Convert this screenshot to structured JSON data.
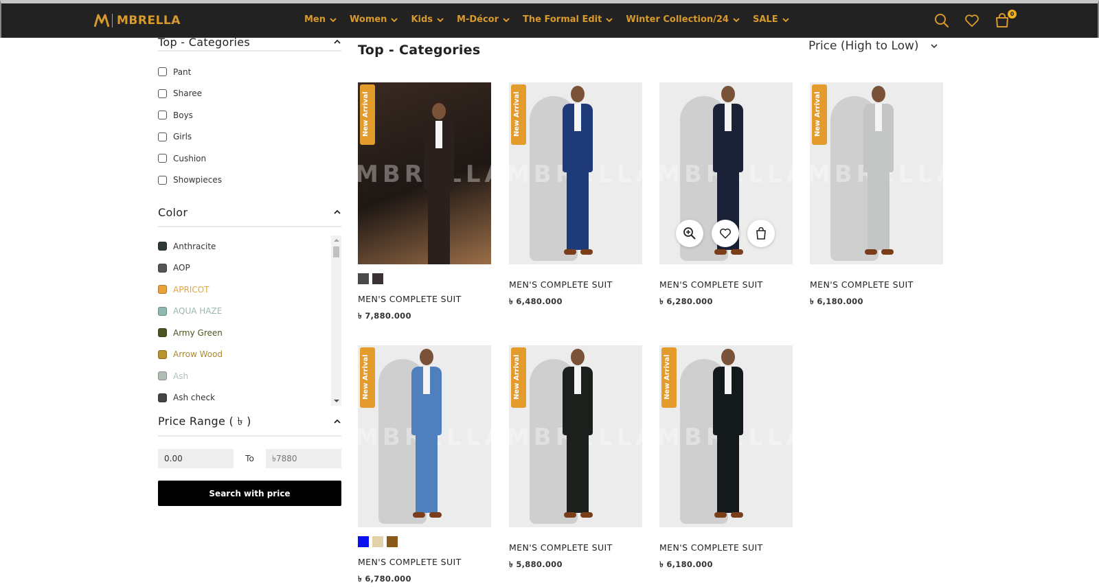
{
  "brand": {
    "name": "MBRELLA",
    "accent": "#d89a2b"
  },
  "nav": {
    "items": [
      {
        "label": "Men",
        "icon": "chevron-down-icon"
      },
      {
        "label": "Women",
        "icon": "chevron-down-icon"
      },
      {
        "label": "Kids",
        "icon": "chevron-down-icon"
      },
      {
        "label": "M-Décor",
        "icon": "chevron-down-icon"
      },
      {
        "label": "The Formal Edit",
        "icon": "chevron-down-icon"
      },
      {
        "label": "Winter Collection/24",
        "icon": "chevron-down-icon"
      },
      {
        "label": "SALE",
        "icon": "chevron-down-icon"
      }
    ],
    "icons": [
      "search-icon",
      "heart-icon",
      "cart-icon"
    ],
    "cart_count": "0"
  },
  "sidebar": {
    "categories": {
      "title": "Top - Categories",
      "items": [
        "Pant",
        "Sharee",
        "Boys",
        "Girls",
        "Cushion",
        "Showpieces"
      ]
    },
    "color": {
      "title": "Color",
      "items": [
        {
          "label": "Anthracite",
          "swatch": "#2f3a36",
          "text_color": "#333333"
        },
        {
          "label": "AOP",
          "swatch": "#555555",
          "text_color": "#333333"
        },
        {
          "label": "APRICOT",
          "swatch": "#e9a23b",
          "text_color": "#e9a23b"
        },
        {
          "label": "AQUA HAZE",
          "swatch": "#8fb8b0",
          "text_color": "#9ab8b3"
        },
        {
          "label": "Army Green",
          "swatch": "#4b5320",
          "text_color": "#4b5320"
        },
        {
          "label": "Arrow Wood",
          "swatch": "#b8922e",
          "text_color": "#a88a2e"
        },
        {
          "label": "Ash",
          "swatch": "#b2beb5",
          "text_color": "#b2beb5"
        },
        {
          "label": "Ash check",
          "swatch": "#444444",
          "text_color": "#333333"
        }
      ]
    },
    "price": {
      "title": "Price Range ( ৳ )",
      "min": "0.00",
      "to_label": "To",
      "max_placeholder": "৳7880",
      "button": "Search with price"
    }
  },
  "main": {
    "title": "Top - Categories",
    "sort": "Price (High to Low)",
    "products": [
      {
        "name": "MEN'S COMPLETE SUIT",
        "price": "৳ 7,880.000",
        "new_arrival": true,
        "swatches": [
          "#4a4a4a",
          "#3a3133"
        ],
        "suit_color": "#2a211e",
        "style": "dark"
      },
      {
        "name": "MEN'S COMPLETE SUIT",
        "price": "৳ 6,480.000",
        "new_arrival": true,
        "swatches": [],
        "suit_color": "#1f3a78",
        "style": "studio"
      },
      {
        "name": "MEN'S COMPLETE SUIT",
        "price": "৳ 6,280.000",
        "new_arrival": false,
        "swatches": [],
        "suit_color": "#1b2136",
        "style": "studio",
        "hover": true
      },
      {
        "name": "MEN'S COMPLETE SUIT",
        "price": "৳ 6,180.000",
        "new_arrival": true,
        "swatches": [],
        "suit_color": "#c4c6c5",
        "style": "studio"
      },
      {
        "name": "MEN'S COMPLETE SUIT",
        "price": "৳ 6,780.000",
        "new_arrival": true,
        "swatches": [
          "#0a10f0",
          "#e2d2aa",
          "#8a5a19"
        ],
        "suit_color": "#4f80bd",
        "style": "studio"
      },
      {
        "name": "MEN'S COMPLETE SUIT",
        "price": "৳ 5,880.000",
        "new_arrival": true,
        "swatches": [],
        "suit_color": "#1c201d",
        "style": "studio"
      },
      {
        "name": "MEN'S COMPLETE SUIT",
        "price": "৳ 6,180.000",
        "new_arrival": true,
        "swatches": [],
        "suit_color": "#141a1b",
        "style": "studio"
      }
    ],
    "ribbon_label": "New Arrival",
    "watermark": "MBRELLA"
  }
}
